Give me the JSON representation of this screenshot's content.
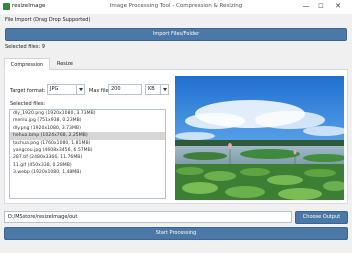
{
  "app": {
    "short_name": "resizeImage",
    "window_title": "Image Processing Tool - Compression & Resizing"
  },
  "window_controls": {
    "minimize": "—",
    "maximize": "☐",
    "close": "✕"
  },
  "file_import": {
    "section_label": "File Import (Drag  Drop Supported)",
    "import_button": "Import Files/Folder",
    "selected_count": "Selected files: 9"
  },
  "tabs": [
    {
      "label": "Compression",
      "active": true
    },
    {
      "label": "Resize",
      "active": false
    }
  ],
  "compression": {
    "target_format_label": "Target format:",
    "target_format_value": "JPG",
    "max_size_label": "Max file size:",
    "max_size_value": "200",
    "unit_value": "KB"
  },
  "selected_files_label": "Selected files:",
  "files": [
    "dly_1920.png (1920x1080, 3.73MB)",
    "menlu.jpg (751x938, 0.23MB)",
    "dly.png (1920x1080, 3.73MB)",
    "hehua.bmp (1024x768, 2.25MB)",
    "tachua.png (1760x1080, 1.81MB)",
    "yangcou.jpg (4608x3456, 6.57MB)",
    "287.tif (2480x3366, 11.76MB)",
    "11.gif (450x338, 0.28MB)",
    "3.webp (1920x1080, 1.48MB)"
  ],
  "selected_file_index": 3,
  "output": {
    "path": "D:/MSstore/resizeImage/out",
    "choose_button": "Choose Output"
  },
  "start_button": "Start Processing",
  "colors": {
    "accent": "#4b78a6",
    "selected_row": "#d6d6d6"
  }
}
